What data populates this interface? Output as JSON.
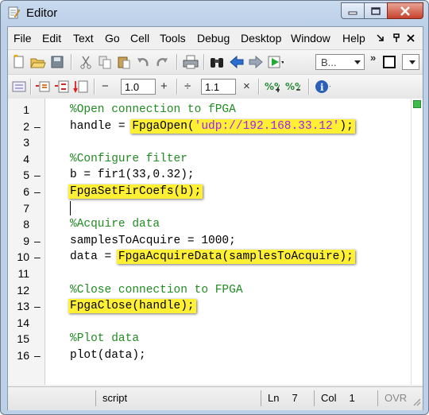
{
  "window": {
    "title": "Editor"
  },
  "menu": [
    "File",
    "Edit",
    "Text",
    "Go",
    "Cell",
    "Tools",
    "Debug",
    "Desktop",
    "Window",
    "Help"
  ],
  "toolbar": {
    "stack_combo": "B...",
    "cell_divide": "1.0",
    "cell_mult": "1.1",
    "cell_minus": "−",
    "cell_plus": "+",
    "cell_div_glyph": "÷",
    "cell_times": "×"
  },
  "code": [
    {
      "n": "1",
      "dash": "",
      "text": "%Open connection to fPGA",
      "kind": "comment"
    },
    {
      "n": "2",
      "dash": "–",
      "pre": "handle = ",
      "fn": "FpgaOpen(",
      "str": "'udp://192.168.33.12'",
      "post": ");",
      "kind": "hlstr"
    },
    {
      "n": "3",
      "dash": "",
      "text": "",
      "kind": "blank"
    },
    {
      "n": "4",
      "dash": "",
      "text": "%Configure filter",
      "kind": "comment"
    },
    {
      "n": "5",
      "dash": "–",
      "text": "b = fir1(33,0.32);",
      "kind": "plain"
    },
    {
      "n": "6",
      "dash": "–",
      "hl": "FpgaSetFirCoefs(b);",
      "kind": "hl"
    },
    {
      "n": "7",
      "dash": "",
      "text": "",
      "kind": "caret"
    },
    {
      "n": "8",
      "dash": "",
      "text": "%Acquire data",
      "kind": "comment"
    },
    {
      "n": "9",
      "dash": "–",
      "text": "samplesToAcquire = 1000;",
      "kind": "plain"
    },
    {
      "n": "10",
      "dash": "–",
      "pre": "data = ",
      "hl": "FpgaAcquireData(samplesToAcquire);",
      "kind": "prehl"
    },
    {
      "n": "11",
      "dash": "",
      "text": "",
      "kind": "blank"
    },
    {
      "n": "12",
      "dash": "",
      "text": "%Close connection to FPGA",
      "kind": "comment"
    },
    {
      "n": "13",
      "dash": "–",
      "hl": "FpgaClose(handle);",
      "kind": "hl"
    },
    {
      "n": "14",
      "dash": "",
      "text": "",
      "kind": "blank"
    },
    {
      "n": "15",
      "dash": "",
      "text": "%Plot data",
      "kind": "comment"
    },
    {
      "n": "16",
      "dash": "–",
      "text": "plot(data);",
      "kind": "plain"
    }
  ],
  "status": {
    "mode": "script",
    "ln_label": "Ln",
    "ln_value": "7",
    "col_label": "Col",
    "col_value": "1",
    "ovr": "OVR"
  },
  "colors": {
    "highlight": "#fff034",
    "comment": "#228b22",
    "string": "#a020f0"
  }
}
